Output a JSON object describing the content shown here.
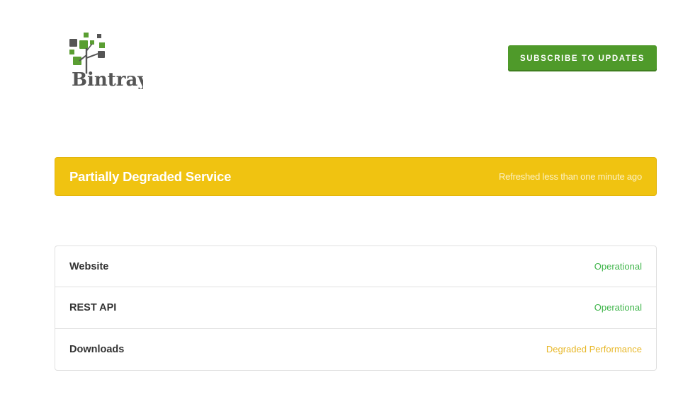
{
  "header": {
    "logo_text": "Bintray",
    "subscribe_label": "SUBSCRIBE TO UPDATES"
  },
  "status": {
    "title": "Partially Degraded Service",
    "refreshed": "Refreshed less than one minute ago"
  },
  "components": [
    {
      "name": "Website",
      "status": "Operational",
      "status_color": "#3fb54a"
    },
    {
      "name": "REST API",
      "status": "Operational",
      "status_color": "#3fb54a"
    },
    {
      "name": "Downloads",
      "status": "Degraded Performance",
      "status_color": "#e8b82a"
    }
  ],
  "colors": {
    "brand_green": "#4f9a2a",
    "banner_yellow": "#f0c311",
    "operational": "#3fb54a",
    "degraded": "#e8b82a",
    "logo_dark": "#555555",
    "logo_green": "#5a9e32"
  }
}
